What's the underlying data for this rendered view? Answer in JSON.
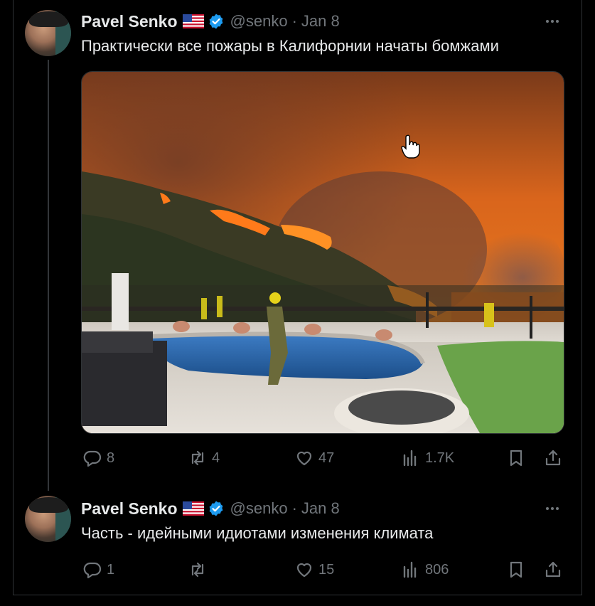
{
  "tweets": [
    {
      "name": "Pavel Senko",
      "handle": "@senko",
      "date": "Jan 8",
      "text": "Практически все пожары в Калифорнии начаты бомжами",
      "has_media": true,
      "media_description_icon": "wildfire-photo",
      "replies": "8",
      "retweets": "4",
      "likes": "47",
      "views": "1.7K"
    },
    {
      "name": "Pavel Senko",
      "handle": "@senko",
      "date": "Jan 8",
      "text": "Часть - идейными идиотами изменения климата",
      "has_media": false,
      "replies": "1",
      "retweets": "",
      "likes": "15",
      "views": "806"
    }
  ],
  "colors": {
    "background": "#000000",
    "text_primary": "#e7e9ea",
    "text_secondary": "#71767b",
    "verified_blue": "#1d9bf0",
    "border": "#2f3336"
  },
  "icons": {
    "more": "more-dots-icon",
    "reply": "reply-icon",
    "retweet": "retweet-icon",
    "like": "heart-icon",
    "views": "views-bar-icon",
    "bookmark": "bookmark-icon",
    "share": "share-icon",
    "verified": "verified-badge-icon",
    "flag": "us-flag-icon"
  }
}
